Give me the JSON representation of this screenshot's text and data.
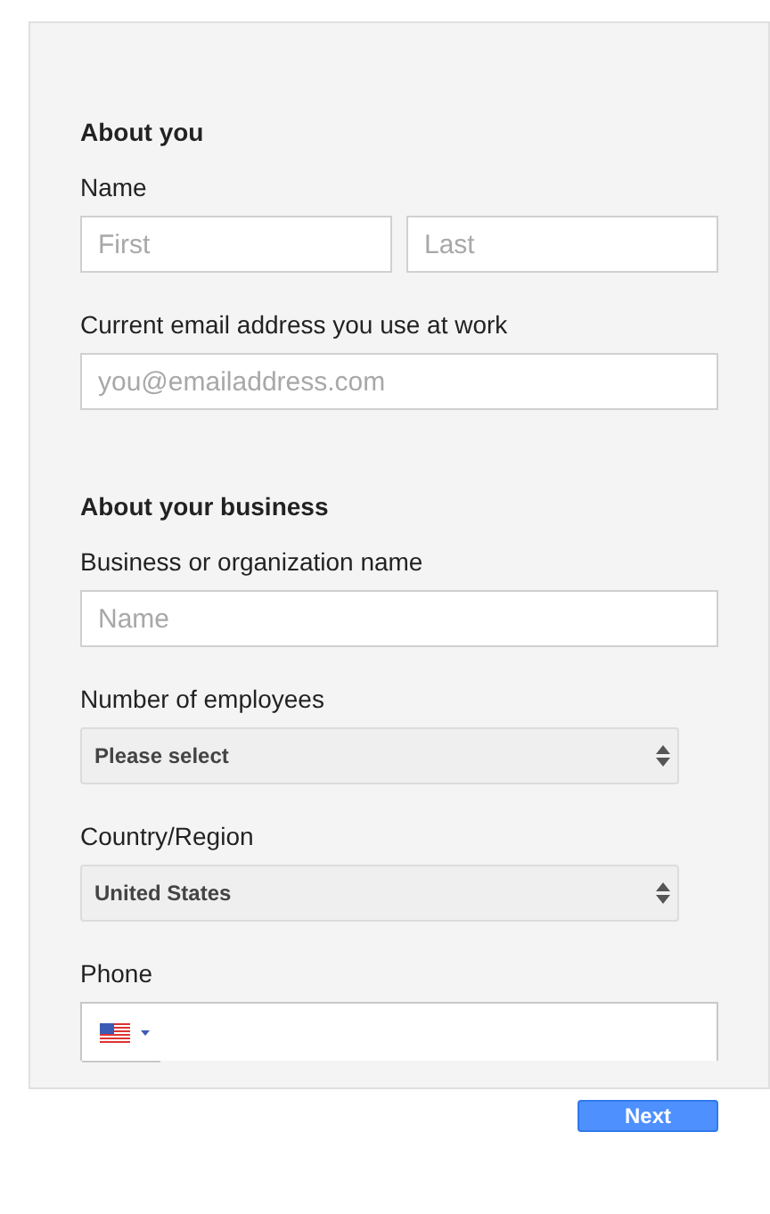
{
  "sections": [
    {
      "heading": "About you",
      "fields": [
        {
          "kind": "text",
          "label": "Name",
          "inputs": [
            {
              "placeholder": "First"
            },
            {
              "placeholder": "Last"
            }
          ]
        },
        {
          "kind": "text",
          "label": "Current email address you use at work",
          "inputs": [
            {
              "placeholder": "you@emailaddress.com"
            }
          ]
        }
      ]
    },
    {
      "heading": "About your business",
      "fields": [
        {
          "kind": "text",
          "label": "Business or organization name",
          "inputs": [
            {
              "placeholder": "Name"
            }
          ]
        },
        {
          "kind": "select",
          "label": "Number of employees",
          "value": "Please select"
        },
        {
          "kind": "select",
          "label": "Country/Region",
          "value": "United States"
        },
        {
          "kind": "phone",
          "label": "Phone"
        }
      ]
    }
  ],
  "next_button": "Next"
}
